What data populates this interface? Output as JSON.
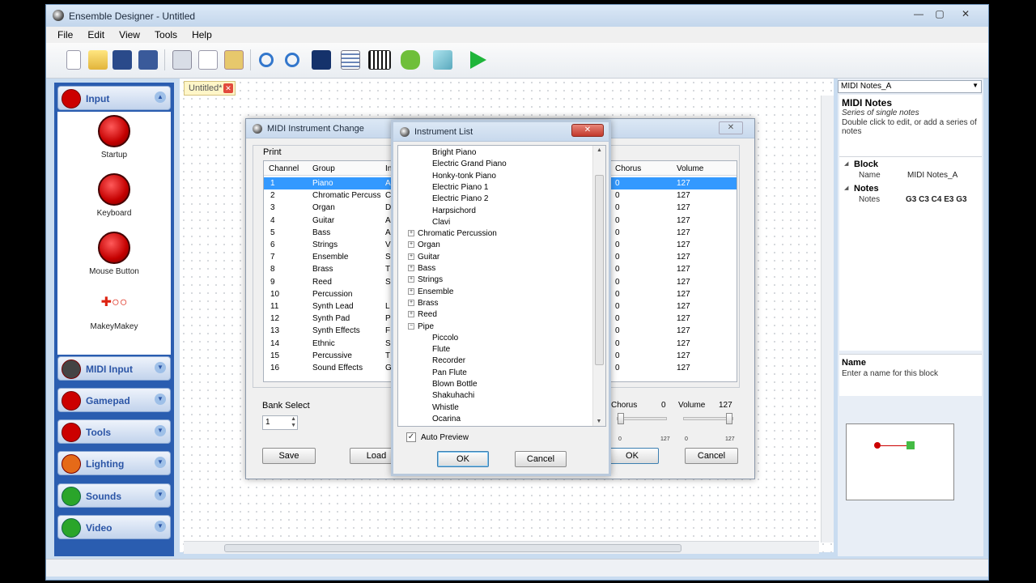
{
  "app": {
    "title": "Ensemble Designer - Untitled",
    "window_controls": [
      "—",
      "▢",
      "✕"
    ]
  },
  "menu": [
    "File",
    "Edit",
    "View",
    "Tools",
    "Help"
  ],
  "toolbar": [
    "new-icon",
    "open-icon",
    "save-icon",
    "save-all-icon",
    "cut-icon",
    "copy-icon",
    "paste-icon",
    "zoom-in-icon",
    "zoom-out-icon",
    "midi-device-icon",
    "list-icon",
    "piano-icon",
    "hand-icon",
    "eraser-icon",
    "play-icon"
  ],
  "doc_tab": {
    "label": "Untitled*",
    "close": "✕"
  },
  "sidebar": {
    "categories": [
      {
        "label": "Input",
        "color": "#cc0000"
      },
      {
        "label": "MIDI Input",
        "color": "#cc2222"
      },
      {
        "label": "Gamepad",
        "color": "#cc2222"
      },
      {
        "label": "Tools",
        "color": "#cc2222"
      },
      {
        "label": "Lighting",
        "color": "#cc2222"
      },
      {
        "label": "Sounds",
        "color": "#22aa22"
      },
      {
        "label": "Video",
        "color": "#22aa22"
      }
    ],
    "input_blocks": [
      "Startup",
      "Keyboard",
      "Mouse Button",
      "MakeyMakey"
    ]
  },
  "right_panel": {
    "combo": "MIDI Notes_A",
    "title": "MIDI Notes",
    "subtitle": "Series of single notes",
    "description": "Double click to edit, or add a series of notes",
    "group_block": "Block",
    "name_key": "Name",
    "name_val": "MIDI Notes_A",
    "group_notes": "Notes",
    "notes_key": "Notes",
    "notes_val": "G3 C3 C4 E3 G3",
    "help_title": "Name",
    "help_text": "Enter a name for this block"
  },
  "midi_dialog": {
    "title": "MIDI Instrument Change",
    "section": "Print",
    "headers": {
      "channel": "Channel",
      "group": "Group",
      "instrument": "In",
      "chorus": "Chorus",
      "volume": "Volume"
    },
    "rows": [
      {
        "ch": "1",
        "group": "Piano",
        "inst": "A",
        "chorus": "0",
        "volume": "127"
      },
      {
        "ch": "2",
        "group": "Chromatic Percuss",
        "inst": "C",
        "chorus": "0",
        "volume": "127"
      },
      {
        "ch": "3",
        "group": "Organ",
        "inst": "D",
        "chorus": "0",
        "volume": "127"
      },
      {
        "ch": "4",
        "group": "Guitar",
        "inst": "A",
        "chorus": "0",
        "volume": "127"
      },
      {
        "ch": "5",
        "group": "Bass",
        "inst": "A",
        "chorus": "0",
        "volume": "127"
      },
      {
        "ch": "6",
        "group": "Strings",
        "inst": "V",
        "chorus": "0",
        "volume": "127"
      },
      {
        "ch": "7",
        "group": "Ensemble",
        "inst": "S",
        "chorus": "0",
        "volume": "127"
      },
      {
        "ch": "8",
        "group": "Brass",
        "inst": "T",
        "chorus": "0",
        "volume": "127"
      },
      {
        "ch": "9",
        "group": "Reed",
        "inst": "S",
        "chorus": "0",
        "volume": "127"
      },
      {
        "ch": "10",
        "group": "Percussion",
        "inst": "",
        "chorus": "0",
        "volume": "127"
      },
      {
        "ch": "11",
        "group": "Synth Lead",
        "inst": "L",
        "chorus": "0",
        "volume": "127"
      },
      {
        "ch": "12",
        "group": "Synth Pad",
        "inst": "P",
        "chorus": "0",
        "volume": "127"
      },
      {
        "ch": "13",
        "group": "Synth Effects",
        "inst": "F",
        "chorus": "0",
        "volume": "127"
      },
      {
        "ch": "14",
        "group": "Ethnic",
        "inst": "S",
        "chorus": "0",
        "volume": "127"
      },
      {
        "ch": "15",
        "group": "Percussive",
        "inst": "T",
        "chorus": "0",
        "volume": "127"
      },
      {
        "ch": "16",
        "group": "Sound Effects",
        "inst": "G",
        "chorus": "0",
        "volume": "127"
      }
    ],
    "bank_label": "Bank Select",
    "bank_value": "1",
    "chorus_label": "Chorus",
    "chorus_value": "0",
    "volume_label": "Volume",
    "volume_value": "127",
    "chorus_scale": [
      "0",
      "127"
    ],
    "volume_scale": [
      "0",
      "127"
    ],
    "save": "Save",
    "load": "Load",
    "ok": "OK",
    "cancel": "Cancel"
  },
  "instrument_list": {
    "title": "Instrument List",
    "items": [
      {
        "label": "Bright Piano",
        "level": 1
      },
      {
        "label": "Electric Grand Piano",
        "level": 1
      },
      {
        "label": "Honky-tonk Piano",
        "level": 1
      },
      {
        "label": "Electric Piano 1",
        "level": 1
      },
      {
        "label": "Electric Piano 2",
        "level": 1
      },
      {
        "label": "Harpsichord",
        "level": 1
      },
      {
        "label": "Clavi",
        "level": 1
      },
      {
        "label": "Chromatic Percussion",
        "level": 0,
        "exp": "+"
      },
      {
        "label": "Organ",
        "level": 0,
        "exp": "+"
      },
      {
        "label": "Guitar",
        "level": 0,
        "exp": "+"
      },
      {
        "label": "Bass",
        "level": 0,
        "exp": "+"
      },
      {
        "label": "Strings",
        "level": 0,
        "exp": "+"
      },
      {
        "label": "Ensemble",
        "level": 0,
        "exp": "+"
      },
      {
        "label": "Brass",
        "level": 0,
        "exp": "+"
      },
      {
        "label": "Reed",
        "level": 0,
        "exp": "+"
      },
      {
        "label": "Pipe",
        "level": 0,
        "exp": "−"
      },
      {
        "label": "Piccolo",
        "level": 1
      },
      {
        "label": "Flute",
        "level": 1
      },
      {
        "label": "Recorder",
        "level": 1
      },
      {
        "label": "Pan Flute",
        "level": 1
      },
      {
        "label": "Blown Bottle",
        "level": 1
      },
      {
        "label": "Shakuhachi",
        "level": 1
      },
      {
        "label": "Whistle",
        "level": 1
      },
      {
        "label": "Ocarina",
        "level": 1
      }
    ],
    "auto_preview": "Auto Preview",
    "auto_preview_checked": true,
    "ok": "OK",
    "cancel": "Cancel"
  }
}
